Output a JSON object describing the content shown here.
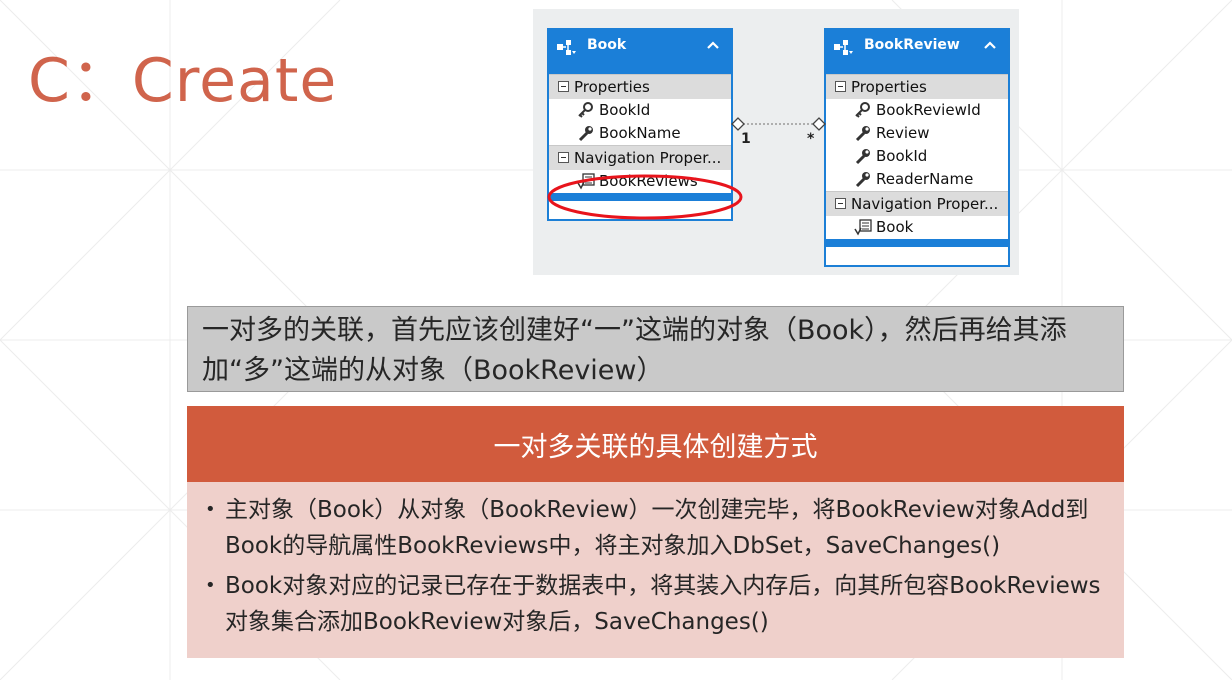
{
  "slide": {
    "title": "C：Create"
  },
  "diagram": {
    "entities": [
      {
        "name": "Book",
        "properties_header": "Properties",
        "properties": [
          {
            "label": "BookId",
            "icon": "key-icon"
          },
          {
            "label": "BookName",
            "icon": "wrench-icon"
          }
        ],
        "navigation_header": "Navigation Proper...",
        "navigation": [
          {
            "label": "BookReviews",
            "icon": "navigation-icon"
          }
        ]
      },
      {
        "name": "BookReview",
        "properties_header": "Properties",
        "properties": [
          {
            "label": "BookReviewId",
            "icon": "key-icon"
          },
          {
            "label": "Review",
            "icon": "wrench-icon"
          },
          {
            "label": "BookId",
            "icon": "wrench-icon"
          },
          {
            "label": "ReaderName",
            "icon": "wrench-icon"
          }
        ],
        "navigation_header": "Navigation Proper...",
        "navigation": [
          {
            "label": "Book",
            "icon": "navigation-icon"
          }
        ]
      }
    ],
    "association": {
      "left_multiplicity": "1",
      "right_multiplicity": "*"
    },
    "highlight_color": "#e8141c",
    "entity_color": "#1b7fd8"
  },
  "note_box": {
    "text": "一对多的关联，首先应该创建好“一”这端的对象（Book），然后再给其添加“多”这端的从对象（BookReview）"
  },
  "panel": {
    "header": "一对多关联的具体创建方式",
    "header_color": "#d15b3d",
    "bullets": [
      "主对象（Book）从对象（BookReview）一次创建完毕，将BookReview对象Add到Book的导航属性BookReviews中，将主对象加入DbSet，SaveChanges()",
      "Book对象对应的记录已存在于数据表中，将其装入内存后，向其所包容BookReviews对象集合添加BookReview对象后，SaveChanges()"
    ]
  }
}
